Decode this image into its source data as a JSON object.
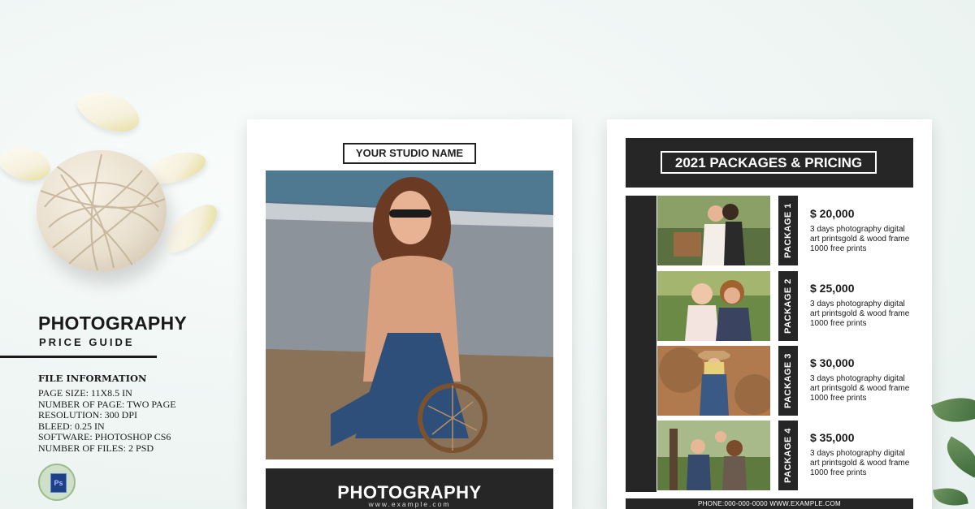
{
  "left_panel": {
    "title": "PHOTOGRAPHY",
    "subtitle": "PRICE GUIDE",
    "file_info_heading": "FILE INFORMATION",
    "file_info_lines": [
      "PAGE SIZE: 11X8.5 IN",
      "NUMBER OF PAGE: TWO PAGE",
      "RESOLUTION: 300 DPI",
      "BLEED: 0.25 IN",
      "SOFTWARE: PHOTOSHOP CS6",
      "NUMBER OF FILES: 2 PSD"
    ],
    "ps_icon_text": "Ps"
  },
  "page1": {
    "studio_name": "YOUR STUDIO NAME",
    "banner_title": "PHOTOGRAPHY",
    "banner_url": "www.example.com"
  },
  "page2": {
    "heading": "2021 PACKAGES & PRICING",
    "packages": [
      {
        "label": "PACKAGE 1",
        "price": "$ 20,000",
        "desc": [
          "3 days photography digital",
          "art printsgold & wood frame",
          "1000 free prints"
        ]
      },
      {
        "label": "PACKAGE 2",
        "price": "$ 25,000",
        "desc": [
          "3 days photography digital",
          "art printsgold & wood frame",
          "1000 free prints"
        ]
      },
      {
        "label": "PACKAGE 3",
        "price": "$ 30,000",
        "desc": [
          "3 days photography digital",
          "art printsgold & wood frame",
          "1000 free prints"
        ]
      },
      {
        "label": "PACKAGE 4",
        "price": "$ 35,000",
        "desc": [
          "3 days photography digital",
          "art printsgold & wood frame",
          "1000 free prints"
        ]
      }
    ],
    "footer": "PHONE:000-000-0000 WWW.EXAMPLE.COM"
  },
  "colors": {
    "dark": "#262626",
    "background": "#eef5f3"
  }
}
